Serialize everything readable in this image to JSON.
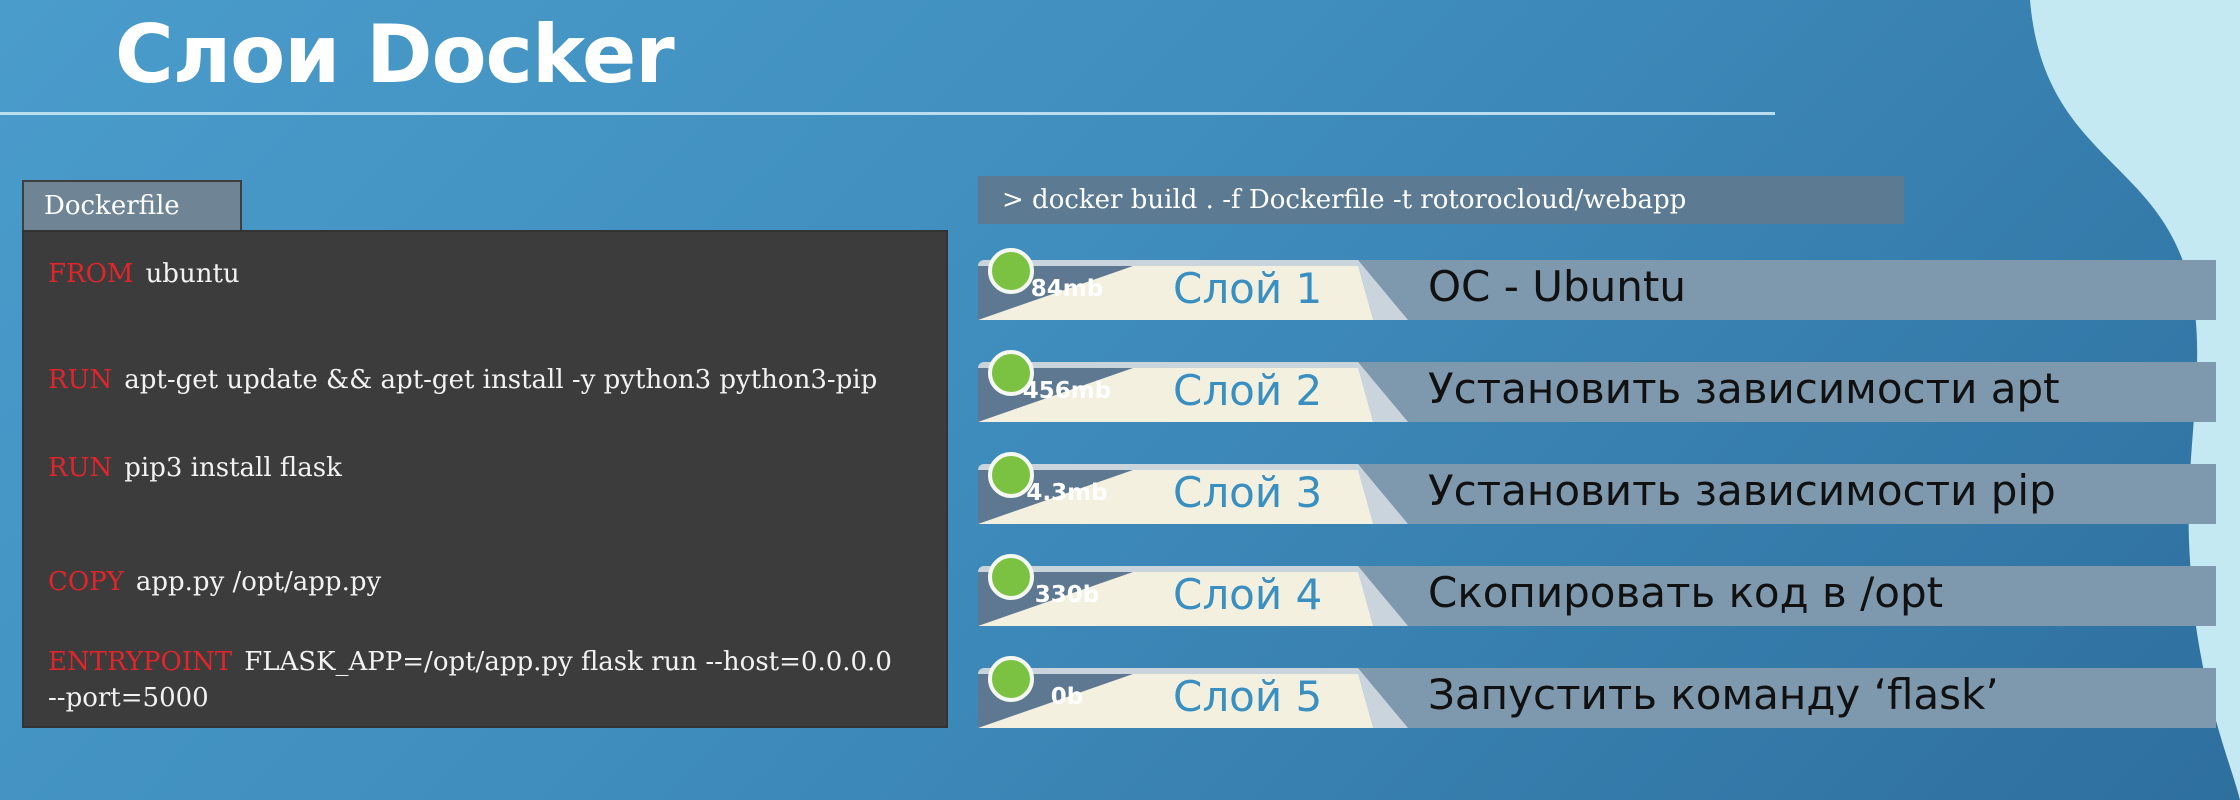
{
  "title": "Слои Docker",
  "dockerfile": {
    "tab_label": "Dockerfile",
    "lines": [
      {
        "keyword": "FROM",
        "text": "ubuntu"
      },
      {
        "keyword": "RUN",
        "text": "apt-get update && apt-get install -y python3 python3-pip"
      },
      {
        "keyword": "RUN",
        "text": "pip3 install flask"
      },
      {
        "keyword": "COPY",
        "text": "app.py /opt/app.py"
      },
      {
        "keyword": "ENTRYPOINT",
        "text": "FLASK_APP=/opt/app.py flask run --host=0.0.0.0",
        "continuation": "--port=5000"
      }
    ]
  },
  "command": "> docker build . -f Dockerfile -t rotorocloud/webapp",
  "layers": [
    {
      "size": "84mb",
      "name": "Слой 1",
      "description": "ОС - Ubuntu"
    },
    {
      "size": "456mb",
      "name": "Слой 2",
      "description": "Установить зависимости apt"
    },
    {
      "size": "4.3mb",
      "name": "Слой 3",
      "description": "Установить зависимости pip"
    },
    {
      "size": "330b",
      "name": "Слой 4",
      "description": "Скопировать код в /opt"
    },
    {
      "size": "0b",
      "name": "Слой 5",
      "description": "Запустить команду ‘flask’"
    }
  ],
  "colors": {
    "background": "#3f8dbd",
    "keyword": "#e0262a",
    "layer_dot": "#7cc242",
    "layer_name": "#3a8fc1"
  }
}
